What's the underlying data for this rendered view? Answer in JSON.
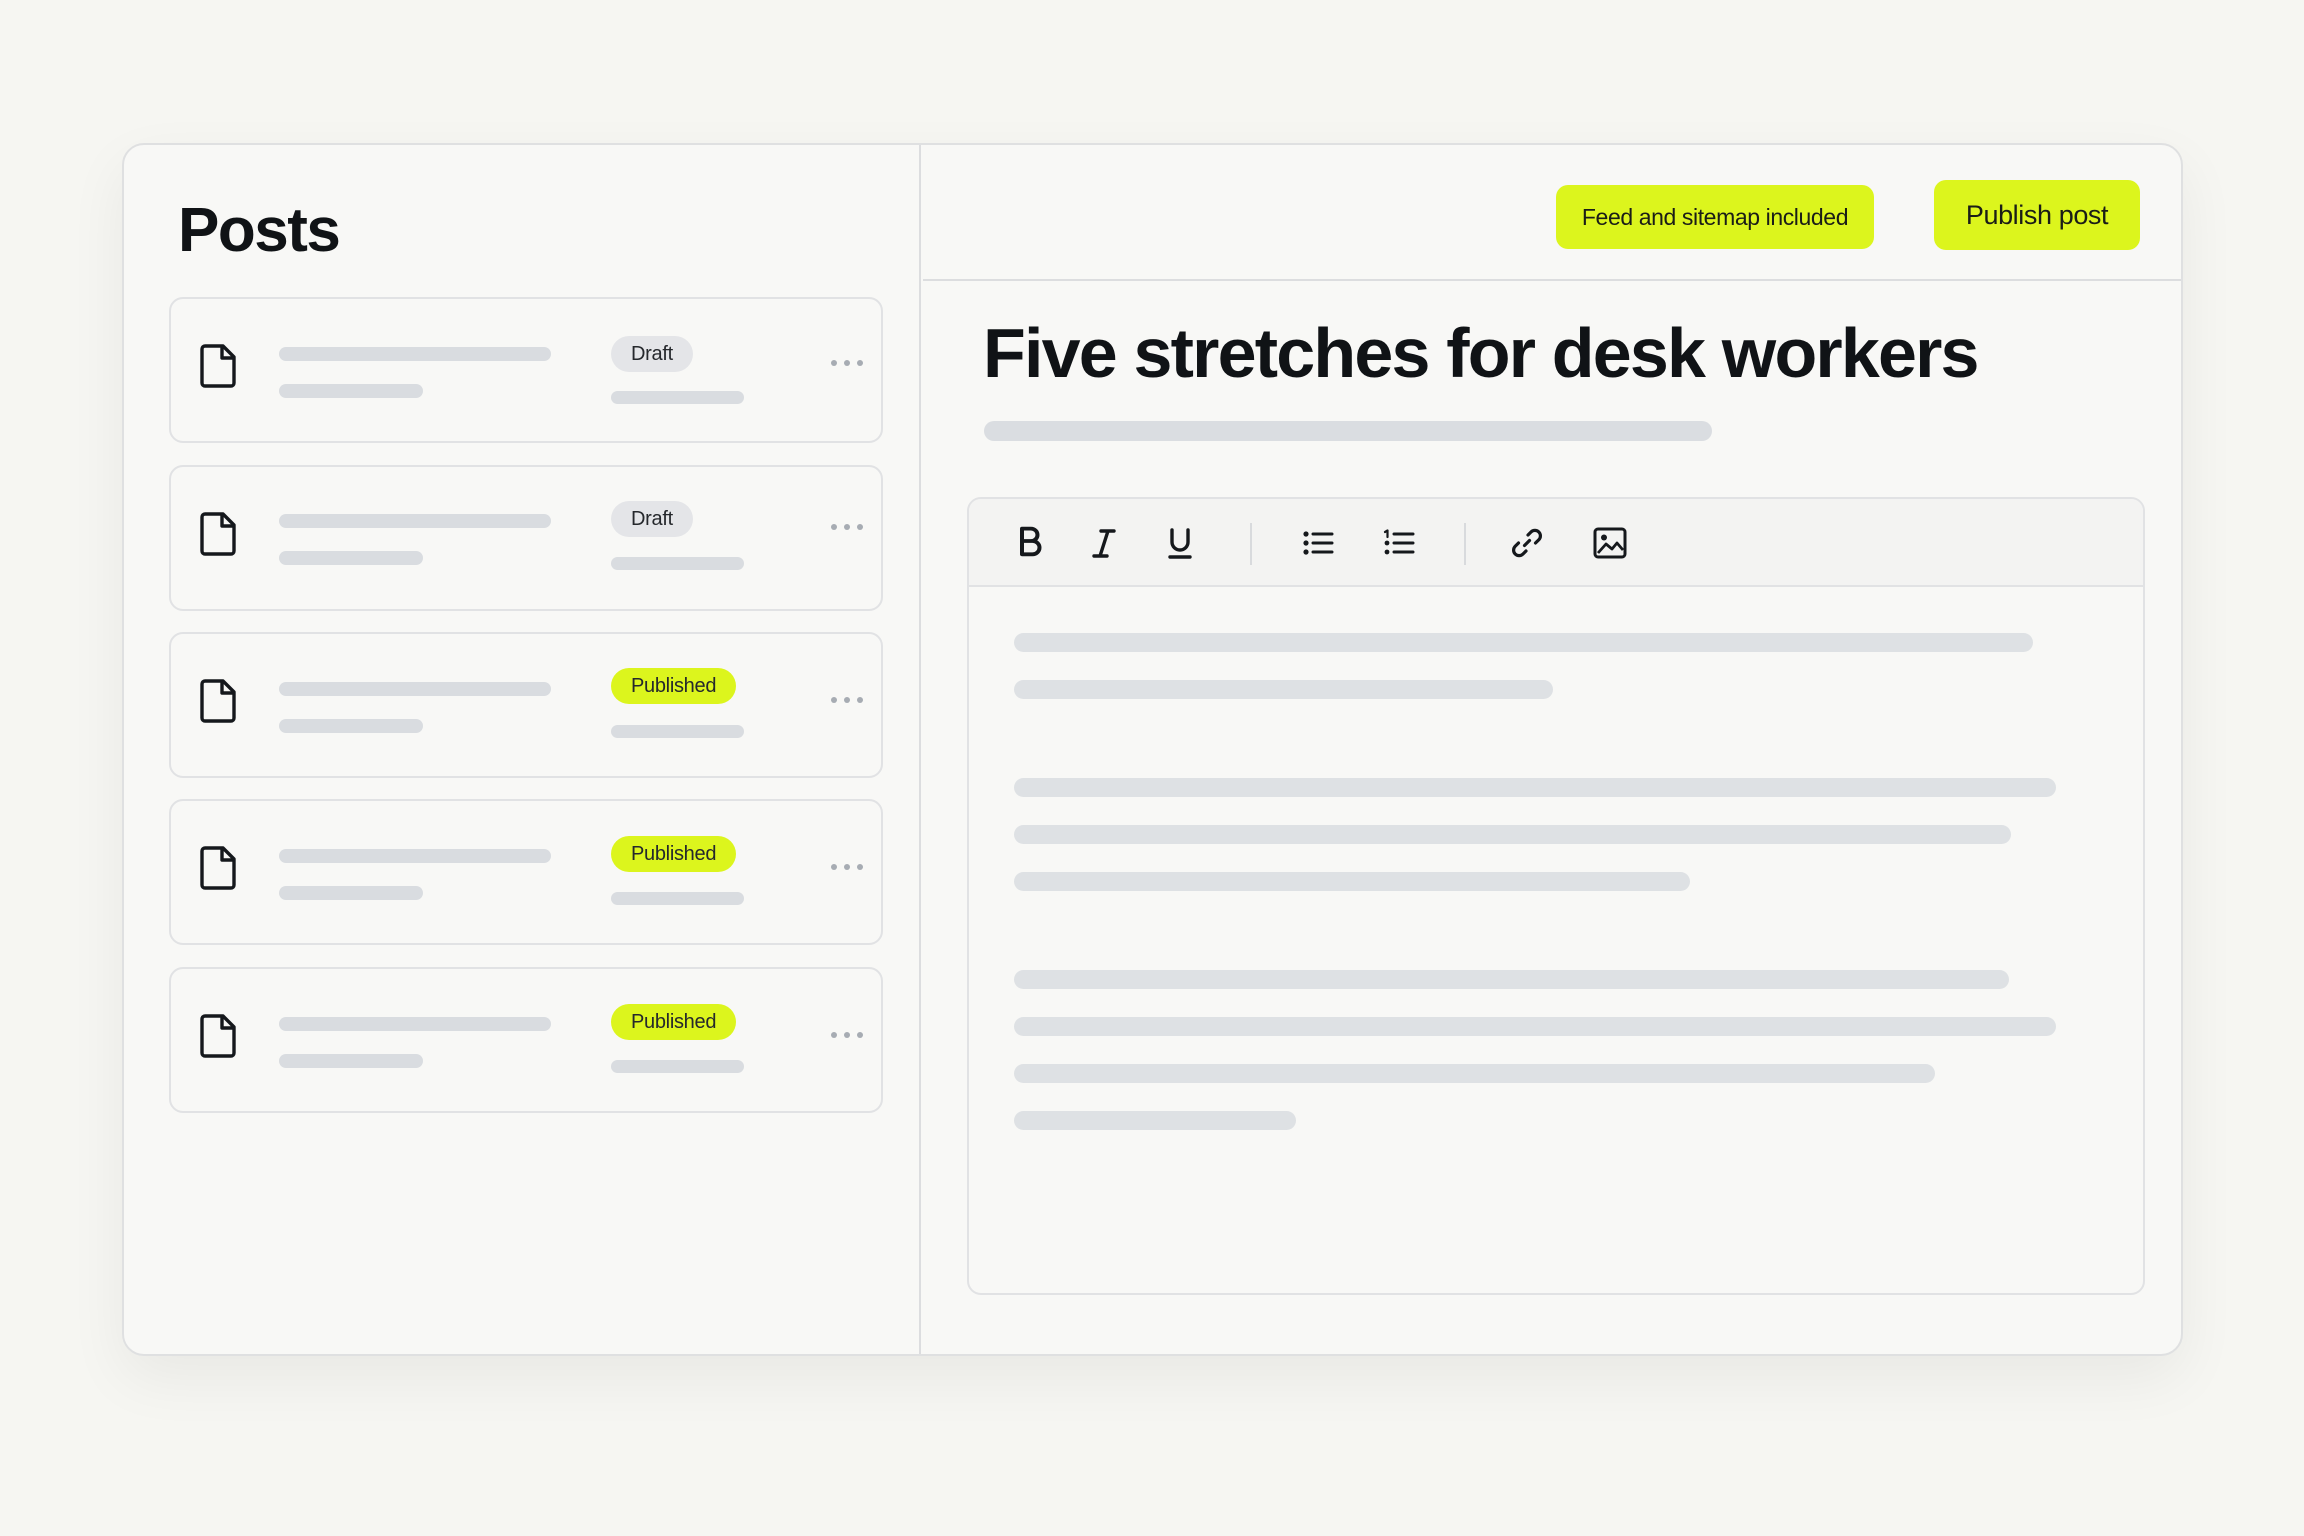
{
  "sidebar": {
    "title": "Posts",
    "posts": [
      {
        "status": "Draft",
        "published": false
      },
      {
        "status": "Draft",
        "published": false
      },
      {
        "status": "Published",
        "published": true
      },
      {
        "status": "Published",
        "published": true
      },
      {
        "status": "Published",
        "published": true
      }
    ]
  },
  "header": {
    "feed_badge": "Feed and sitemap included",
    "publish_label": "Publish post"
  },
  "editor": {
    "title": "Five stretches for desk workers",
    "toolbar": [
      "bold-icon",
      "italic-icon",
      "underline-icon",
      "bullet-list-icon",
      "numbered-list-icon",
      "link-icon",
      "image-icon"
    ]
  },
  "colors": {
    "accent": "#dcf51d",
    "draft_badge": "#e4e5e8",
    "placeholder": "#d9dce0"
  }
}
